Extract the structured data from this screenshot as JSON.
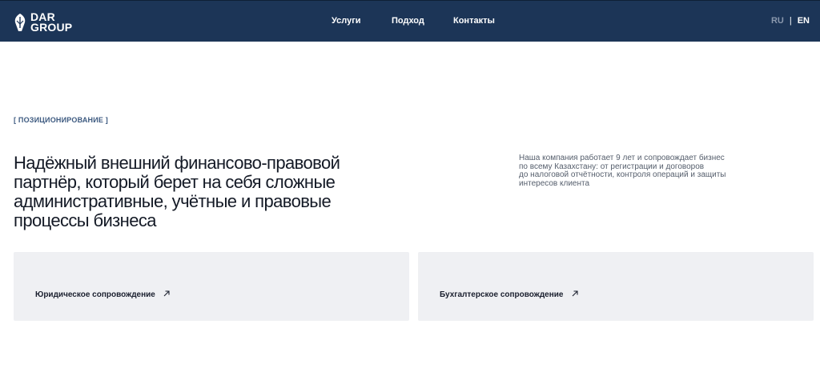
{
  "header": {
    "logo": {
      "line1": "DAR",
      "line2": "GROUP",
      "icon": "leaf-pen-icon"
    },
    "nav": [
      {
        "label": "Услуги"
      },
      {
        "label": "Подход"
      },
      {
        "label": "Контакты"
      }
    ],
    "lang": {
      "ru": "RU",
      "separator": "|",
      "en": "EN",
      "active": "EN"
    }
  },
  "hero": {
    "section_tag": "[ ПОЗИЦИОНИРОВАНИЕ ]",
    "headline": "Надёжный внешний финансово-правовой партнёр, который берет на себя сложные административные, учётные и правовые процессы бизнеса",
    "description_lines": [
      "Наша компания работает 9 лет и сопровождает бизнес",
      "по всему Казахстану: от регистрации и договоров",
      "до налоговой отчётности, контроля операций и защиты",
      "интересов клиента"
    ]
  },
  "cards": [
    {
      "label": "Юридическое сопровождение",
      "icon": "arrow-up-right-icon"
    },
    {
      "label": "Бухгалтерское сопровождение",
      "icon": "arrow-up-right-icon"
    }
  ],
  "colors": {
    "header_bg": "#1c3557",
    "card_bg": "#eff0f3",
    "tag": "#3d5a80",
    "lang_inactive": "#8a98ad"
  }
}
